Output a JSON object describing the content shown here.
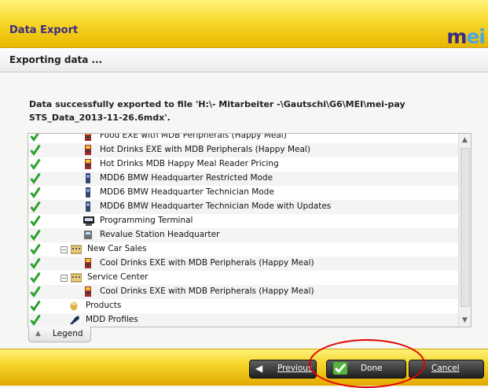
{
  "window": {
    "title": "Data Export",
    "logo_main": "m",
    "logo_accent": "ei"
  },
  "header": {
    "subtitle": "Exporting data ..."
  },
  "message": "Data successfully exported to file 'H:\\- Mitarbeiter -\\Gautschi\\G6\\MEI\\mei-pay STS_Data_2013-11-26.6mdx'.",
  "tree": {
    "rows": [
      {
        "label": "Food EXE with MDB Peripherals (Happy Meal)",
        "icon": "machine-icon",
        "level": 3
      },
      {
        "label": "Hot Drinks EXE with MDB Peripherals (Happy Meal)",
        "icon": "machine-icon",
        "level": 3
      },
      {
        "label": "Hot Drinks MDB Happy Meal Reader Pricing",
        "icon": "machine-icon",
        "level": 3
      },
      {
        "label": "MDD6 BMW Headquarter Restricted Mode",
        "icon": "device-icon",
        "level": 3
      },
      {
        "label": "MDD6 BMW Headquarter Technician Mode",
        "icon": "device-icon",
        "level": 3
      },
      {
        "label": "MDD6 BMW Headquarter Technician Mode with Updates",
        "icon": "device-icon",
        "level": 3
      },
      {
        "label": "Programming Terminal",
        "icon": "terminal-icon",
        "level": 3
      },
      {
        "label": "Revalue Station Headquarter",
        "icon": "station-icon",
        "level": 3
      },
      {
        "label": "New Car Sales",
        "icon": "building-icon",
        "level": 2,
        "expander": "−"
      },
      {
        "label": "Cool Drinks EXE with MDB Peripherals (Happy Meal)",
        "icon": "machine-icon",
        "level": 3
      },
      {
        "label": "Service Center",
        "icon": "building-icon",
        "level": 2,
        "expander": "−"
      },
      {
        "label": "Cool Drinks EXE with MDB Peripherals (Happy Meal)",
        "icon": "machine-icon",
        "level": 3
      },
      {
        "label": "Products",
        "icon": "products-icon",
        "level": 1
      },
      {
        "label": "MDD Profiles",
        "icon": "profile-icon",
        "level": 1
      }
    ]
  },
  "legend": {
    "label": "Legend",
    "icon": "triangle-up-icon"
  },
  "buttons": {
    "previous": {
      "label": "Previous",
      "icon": "arrow-left-icon"
    },
    "done": {
      "label": "Done",
      "icon": "check-icon"
    },
    "cancel": {
      "label": "Cancel"
    }
  },
  "colors": {
    "accent": "#f5d327",
    "brand": "#3a2a86",
    "check": "#2da12d",
    "highlight": "#e10000"
  }
}
